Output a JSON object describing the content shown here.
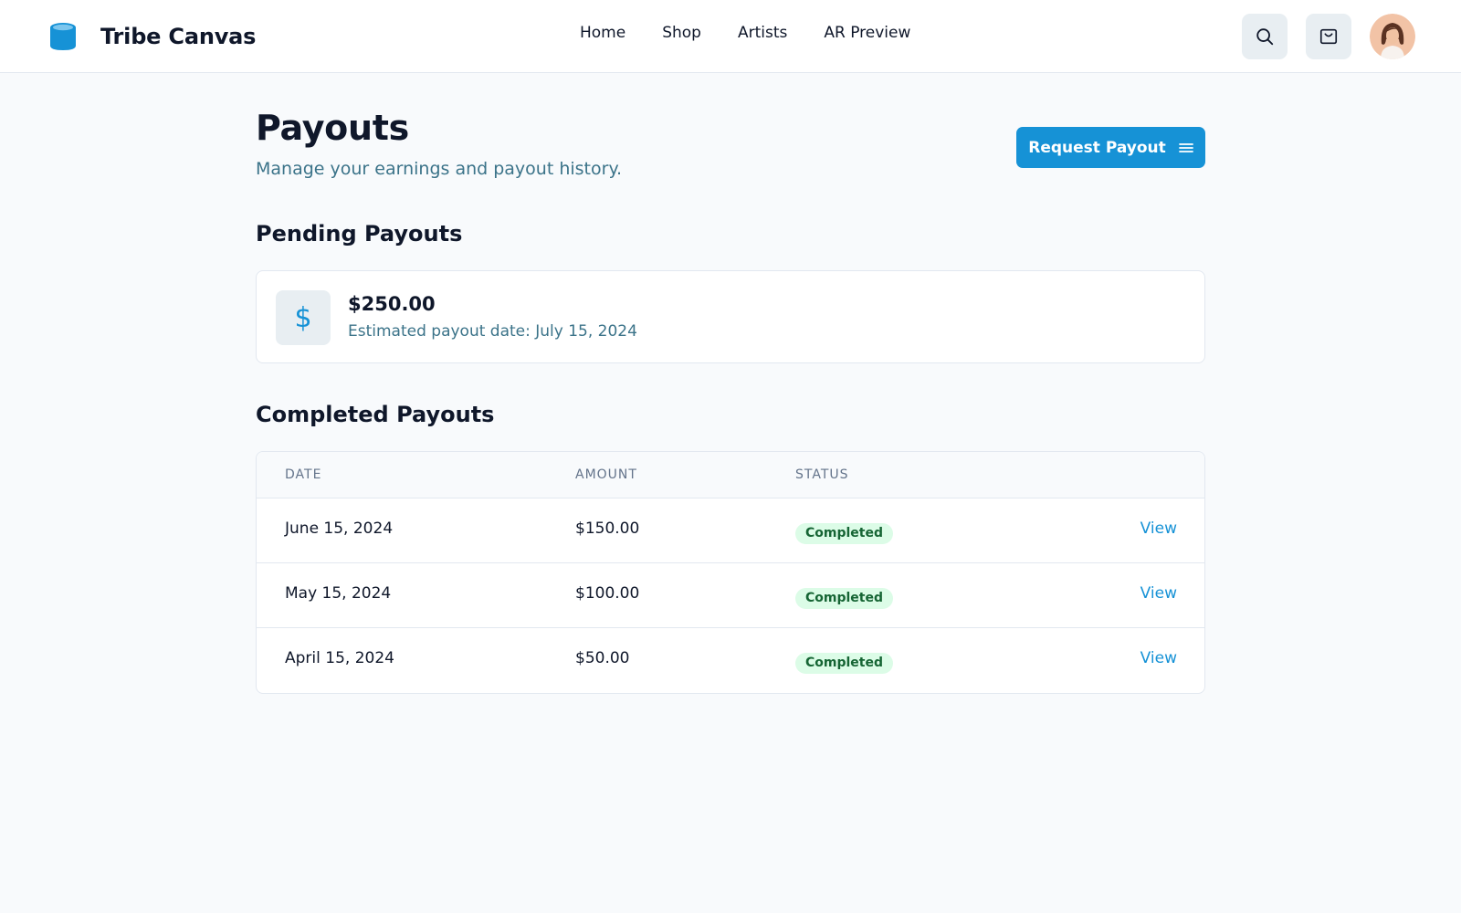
{
  "header": {
    "brand_name": "Tribe Canvas",
    "nav": [
      {
        "label": "Home"
      },
      {
        "label": "Shop"
      },
      {
        "label": "Artists"
      },
      {
        "label": "AR Preview"
      }
    ],
    "icons": [
      "search-icon",
      "shopping-bag-icon",
      "avatar"
    ]
  },
  "page": {
    "title": "Payouts",
    "subtitle": "Manage your earnings and payout history.",
    "request_button_label": "Request Payout"
  },
  "pending": {
    "section_title": "Pending Payouts",
    "amount": "$250.00",
    "date_text": "Estimated payout date: July 15, 2024",
    "icon_glyph": "$"
  },
  "completed": {
    "section_title": "Completed Payouts",
    "columns": [
      "DATE",
      "AMOUNT",
      "STATUS"
    ],
    "rows": [
      {
        "date": "June 15, 2024",
        "amount": "$150.00",
        "status": "Completed",
        "action": "View"
      },
      {
        "date": "May 15, 2024",
        "amount": "$100.00",
        "status": "Completed",
        "action": "View"
      },
      {
        "date": "April 15, 2024",
        "amount": "$50.00",
        "status": "Completed",
        "action": "View"
      }
    ]
  },
  "colors": {
    "accent": "#1692d6",
    "muted_text": "#3b7389",
    "badge_bg": "#dcfce7",
    "badge_text": "#166534"
  }
}
